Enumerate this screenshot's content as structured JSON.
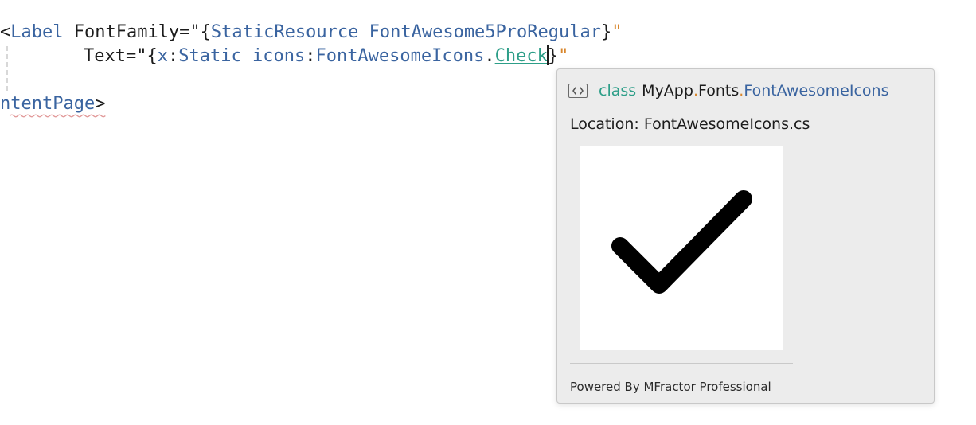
{
  "editor": {
    "line1": {
      "open": "<",
      "tag": "Label",
      "attr": " FontFamily=\"",
      "brace_open": "{",
      "resource_kw": "StaticResource",
      "space": " ",
      "resource_name": "FontAwesome5ProRegular",
      "brace_close": "}",
      "quote_end": "\""
    },
    "line2": {
      "attr": "Text=\"",
      "brace_open": "{",
      "ns": "x",
      "colon": ":",
      "static_kw": "Static",
      "space": " ",
      "icons_ns": "icons",
      "colon2": ":",
      "class_name": "FontAwesomeIcons",
      "dot": ".",
      "member": "Check",
      "brace_close": "}",
      "quote_end": "\""
    },
    "line3": {
      "tag_fragment": "ntentPage",
      "close": ">"
    }
  },
  "popup": {
    "icon": "code-brackets-icon",
    "keyword": "class",
    "namespace_parts": [
      "MyApp",
      "Fonts"
    ],
    "separator": ".",
    "type_name": "FontAwesomeIcons",
    "location_label": "Location:",
    "location_file": "FontAwesomeIcons.cs",
    "preview_icon": "checkmark-icon",
    "footer": "Powered By MFractor Professional"
  },
  "colors": {
    "tag": "#3a64a0",
    "link": "#2d9e88",
    "accent_orange": "#d8862c",
    "popup_bg": "#ececec"
  }
}
